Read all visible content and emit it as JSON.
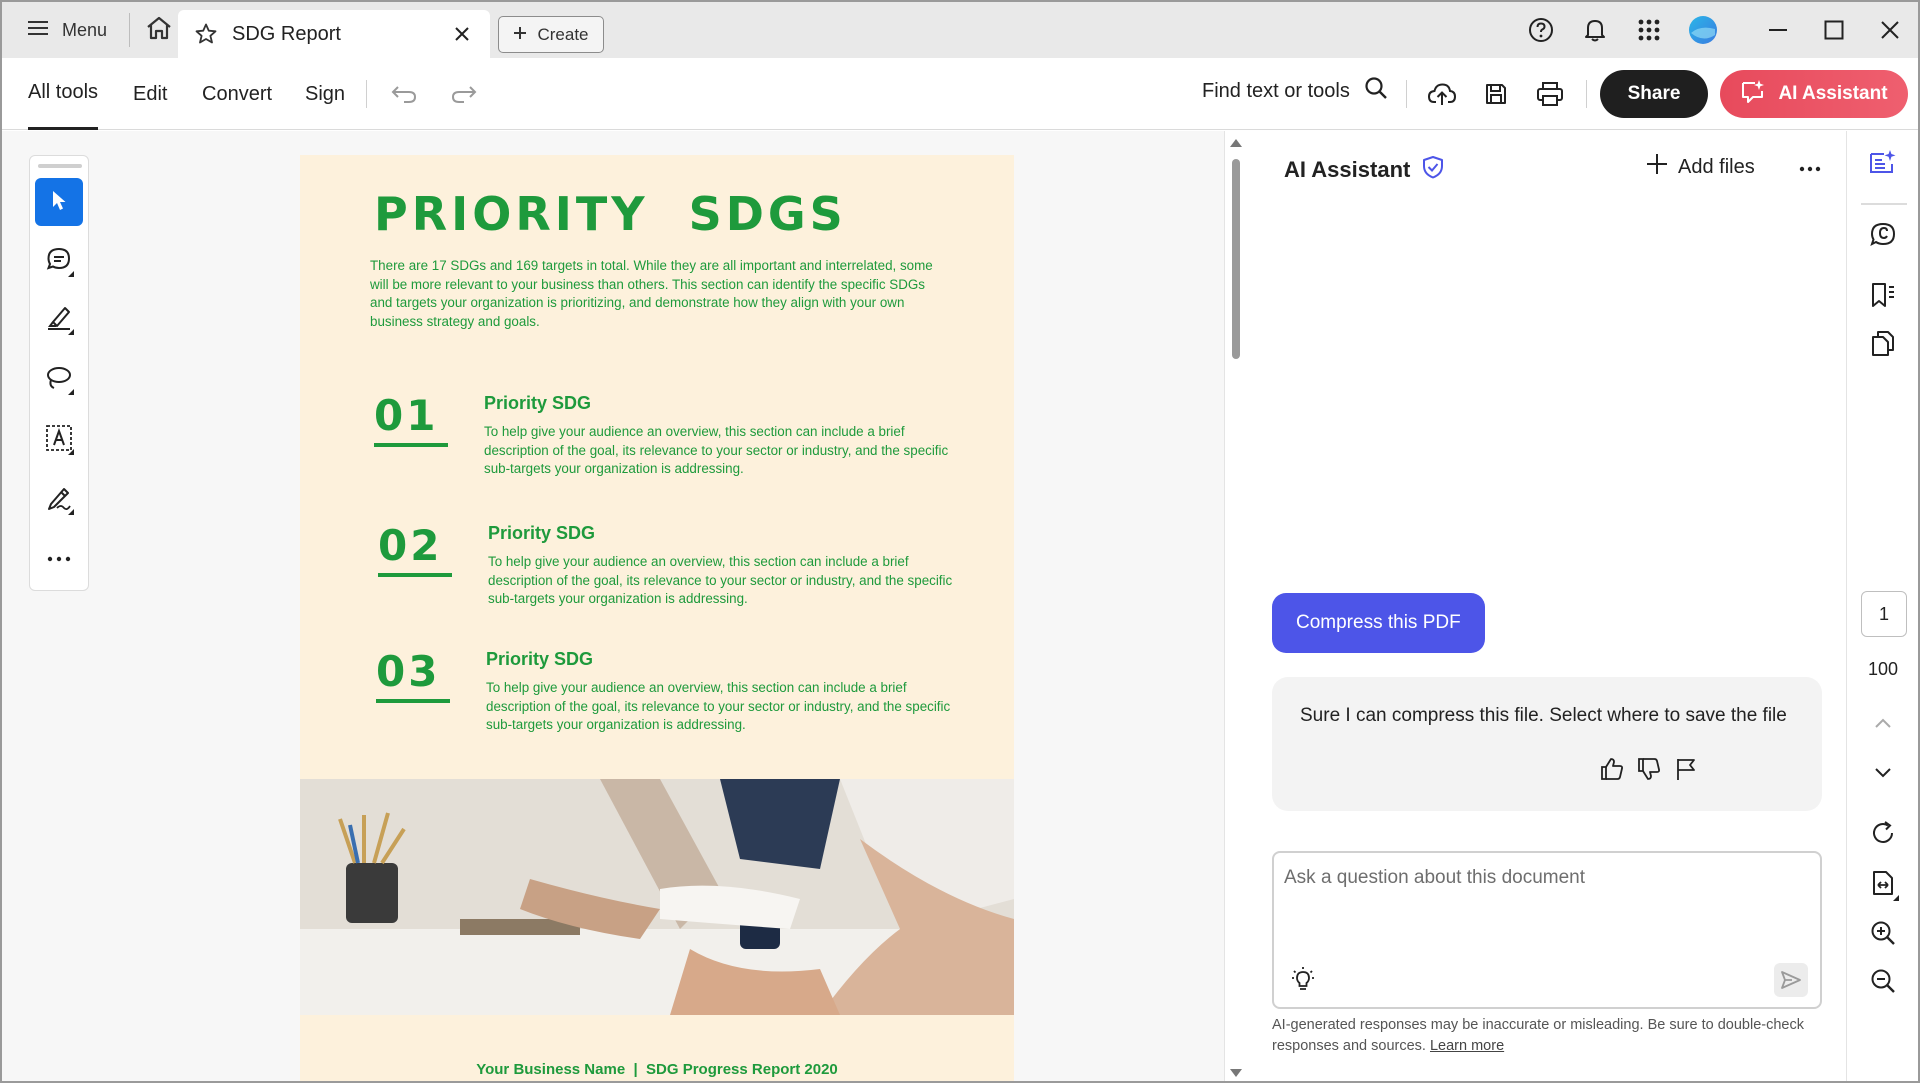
{
  "titlebar": {
    "menu_label": "Menu",
    "tab_title": "SDG Report",
    "create_label": "Create"
  },
  "toolbar": {
    "nav": [
      "All tools",
      "Edit",
      "Convert",
      "Sign"
    ],
    "find_label": "Find text or tools",
    "share_label": "Share",
    "ai_assistant_label": "AI Assistant"
  },
  "document": {
    "title": "PRIORITY  SDGS",
    "intro": "There are 17 SDGs and 169 targets in total. While they are all important and interrelated, some will be more relevant to your business than others. This section can identify the specific SDGs and targets your organization is prioritizing, and demonstrate how they align with your own business strategy and goals.",
    "items": [
      {
        "num": "01",
        "heading": "Priority SDG",
        "desc": "To help give your audience an overview, this section can include a brief description of the goal, its relevance to your sector or industry, and the specific sub-targets your organization is addressing."
      },
      {
        "num": "02",
        "heading": "Priority SDG",
        "desc": "To help give your audience an overview, this section can include a brief description of the goal, its relevance to your sector or industry, and the specific sub-targets your organization is addressing."
      },
      {
        "num": "03",
        "heading": "Priority SDG",
        "desc": "To help give your audience an overview, this section can include a brief description of the goal, its relevance to your sector or industry, and the specific sub-targets your organization is addressing."
      }
    ],
    "footer": "Your Business Name  |  SDG Progress Report 2020"
  },
  "ai_panel": {
    "title": "AI Assistant",
    "add_files_label": "Add files",
    "user_message": "Compress this PDF",
    "assistant_reply": "Sure I can compress this file. Select where to save the file",
    "input_placeholder": "Ask a question about this document",
    "disclaimer": "AI-generated responses may be inaccurate or misleading. Be sure to double-check responses and sources.",
    "learn_more": "Learn more"
  },
  "rail": {
    "page_number": "1",
    "page_total": "100"
  },
  "colors": {
    "sdg_green": "#1e9a3c",
    "page_bg": "#fdf1dc",
    "accent_blue": "#1473e6",
    "chip_purple": "#4d55e8",
    "ai_button_red": "#e74a5c"
  },
  "icons": [
    "hamburger-icon",
    "home-icon",
    "star-icon",
    "close-icon",
    "plus-icon",
    "help-icon",
    "bell-icon",
    "apps-grid-icon",
    "avatar",
    "minimize-icon",
    "maximize-icon",
    "window-close-icon",
    "undo-icon",
    "redo-icon",
    "search-icon",
    "upload-cloud-icon",
    "save-icon",
    "print-icon",
    "ai-sparkle-icon",
    "select-pointer-icon",
    "comment-icon",
    "highlight-pen-icon",
    "lasso-draw-icon",
    "text-box-icon",
    "signature-pen-icon",
    "more-dots-icon",
    "shield-check-icon",
    "thumbs-up-icon",
    "thumbs-down-icon",
    "flag-icon",
    "lightbulb-icon",
    "send-icon",
    "rotate-icon",
    "fit-page-icon",
    "zoom-in-icon",
    "zoom-out-icon",
    "bookmark-icon",
    "pages-icon",
    "attach-comment-icon"
  ]
}
